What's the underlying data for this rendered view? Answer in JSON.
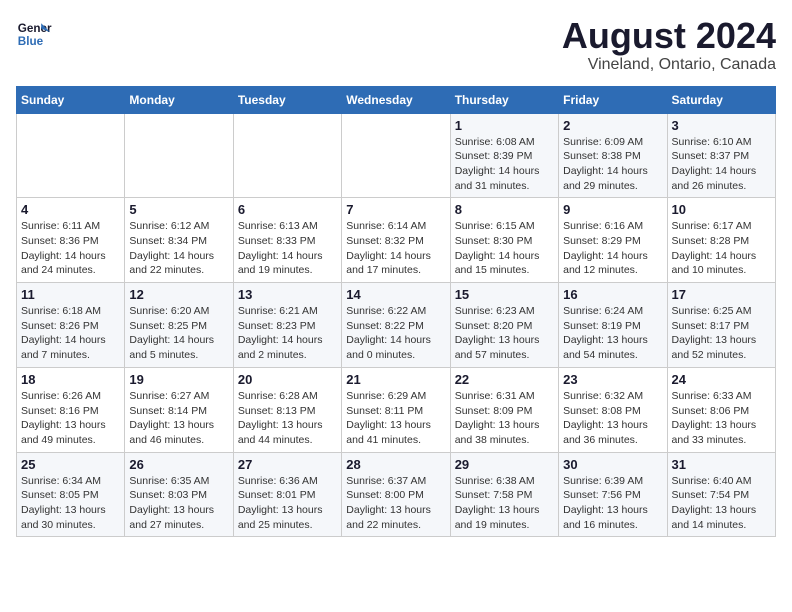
{
  "header": {
    "logo_line1": "General",
    "logo_line2": "Blue",
    "title": "August 2024",
    "subtitle": "Vineland, Ontario, Canada"
  },
  "days_of_week": [
    "Sunday",
    "Monday",
    "Tuesday",
    "Wednesday",
    "Thursday",
    "Friday",
    "Saturday"
  ],
  "weeks": [
    [
      {
        "day": "",
        "info": ""
      },
      {
        "day": "",
        "info": ""
      },
      {
        "day": "",
        "info": ""
      },
      {
        "day": "",
        "info": ""
      },
      {
        "day": "1",
        "info": "Sunrise: 6:08 AM\nSunset: 8:39 PM\nDaylight: 14 hours\nand 31 minutes."
      },
      {
        "day": "2",
        "info": "Sunrise: 6:09 AM\nSunset: 8:38 PM\nDaylight: 14 hours\nand 29 minutes."
      },
      {
        "day": "3",
        "info": "Sunrise: 6:10 AM\nSunset: 8:37 PM\nDaylight: 14 hours\nand 26 minutes."
      }
    ],
    [
      {
        "day": "4",
        "info": "Sunrise: 6:11 AM\nSunset: 8:36 PM\nDaylight: 14 hours\nand 24 minutes."
      },
      {
        "day": "5",
        "info": "Sunrise: 6:12 AM\nSunset: 8:34 PM\nDaylight: 14 hours\nand 22 minutes."
      },
      {
        "day": "6",
        "info": "Sunrise: 6:13 AM\nSunset: 8:33 PM\nDaylight: 14 hours\nand 19 minutes."
      },
      {
        "day": "7",
        "info": "Sunrise: 6:14 AM\nSunset: 8:32 PM\nDaylight: 14 hours\nand 17 minutes."
      },
      {
        "day": "8",
        "info": "Sunrise: 6:15 AM\nSunset: 8:30 PM\nDaylight: 14 hours\nand 15 minutes."
      },
      {
        "day": "9",
        "info": "Sunrise: 6:16 AM\nSunset: 8:29 PM\nDaylight: 14 hours\nand 12 minutes."
      },
      {
        "day": "10",
        "info": "Sunrise: 6:17 AM\nSunset: 8:28 PM\nDaylight: 14 hours\nand 10 minutes."
      }
    ],
    [
      {
        "day": "11",
        "info": "Sunrise: 6:18 AM\nSunset: 8:26 PM\nDaylight: 14 hours\nand 7 minutes."
      },
      {
        "day": "12",
        "info": "Sunrise: 6:20 AM\nSunset: 8:25 PM\nDaylight: 14 hours\nand 5 minutes."
      },
      {
        "day": "13",
        "info": "Sunrise: 6:21 AM\nSunset: 8:23 PM\nDaylight: 14 hours\nand 2 minutes."
      },
      {
        "day": "14",
        "info": "Sunrise: 6:22 AM\nSunset: 8:22 PM\nDaylight: 14 hours\nand 0 minutes."
      },
      {
        "day": "15",
        "info": "Sunrise: 6:23 AM\nSunset: 8:20 PM\nDaylight: 13 hours\nand 57 minutes."
      },
      {
        "day": "16",
        "info": "Sunrise: 6:24 AM\nSunset: 8:19 PM\nDaylight: 13 hours\nand 54 minutes."
      },
      {
        "day": "17",
        "info": "Sunrise: 6:25 AM\nSunset: 8:17 PM\nDaylight: 13 hours\nand 52 minutes."
      }
    ],
    [
      {
        "day": "18",
        "info": "Sunrise: 6:26 AM\nSunset: 8:16 PM\nDaylight: 13 hours\nand 49 minutes."
      },
      {
        "day": "19",
        "info": "Sunrise: 6:27 AM\nSunset: 8:14 PM\nDaylight: 13 hours\nand 46 minutes."
      },
      {
        "day": "20",
        "info": "Sunrise: 6:28 AM\nSunset: 8:13 PM\nDaylight: 13 hours\nand 44 minutes."
      },
      {
        "day": "21",
        "info": "Sunrise: 6:29 AM\nSunset: 8:11 PM\nDaylight: 13 hours\nand 41 minutes."
      },
      {
        "day": "22",
        "info": "Sunrise: 6:31 AM\nSunset: 8:09 PM\nDaylight: 13 hours\nand 38 minutes."
      },
      {
        "day": "23",
        "info": "Sunrise: 6:32 AM\nSunset: 8:08 PM\nDaylight: 13 hours\nand 36 minutes."
      },
      {
        "day": "24",
        "info": "Sunrise: 6:33 AM\nSunset: 8:06 PM\nDaylight: 13 hours\nand 33 minutes."
      }
    ],
    [
      {
        "day": "25",
        "info": "Sunrise: 6:34 AM\nSunset: 8:05 PM\nDaylight: 13 hours\nand 30 minutes."
      },
      {
        "day": "26",
        "info": "Sunrise: 6:35 AM\nSunset: 8:03 PM\nDaylight: 13 hours\nand 27 minutes."
      },
      {
        "day": "27",
        "info": "Sunrise: 6:36 AM\nSunset: 8:01 PM\nDaylight: 13 hours\nand 25 minutes."
      },
      {
        "day": "28",
        "info": "Sunrise: 6:37 AM\nSunset: 8:00 PM\nDaylight: 13 hours\nand 22 minutes."
      },
      {
        "day": "29",
        "info": "Sunrise: 6:38 AM\nSunset: 7:58 PM\nDaylight: 13 hours\nand 19 minutes."
      },
      {
        "day": "30",
        "info": "Sunrise: 6:39 AM\nSunset: 7:56 PM\nDaylight: 13 hours\nand 16 minutes."
      },
      {
        "day": "31",
        "info": "Sunrise: 6:40 AM\nSunset: 7:54 PM\nDaylight: 13 hours\nand 14 minutes."
      }
    ]
  ]
}
